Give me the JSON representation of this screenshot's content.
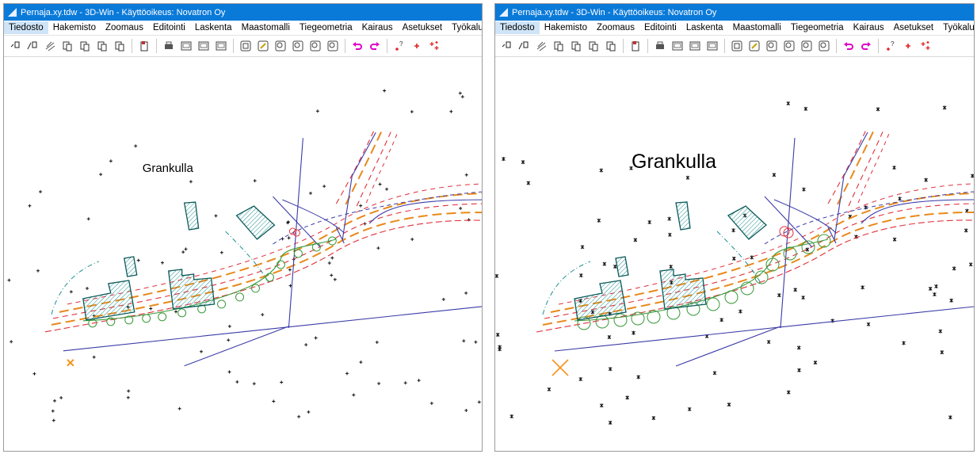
{
  "windows": [
    {
      "title": "Pernaja.xy.tdw - 3D-Win - Käyttöoikeus: Novatron Oy",
      "menu": [
        "Tiedosto",
        "Hakemisto",
        "Zoomaus",
        "Editointi",
        "Laskenta",
        "Maastomalli",
        "Tiegeometria",
        "Kairaus",
        "Asetukset",
        "Työkalut"
      ],
      "active_menu": "Tiedosto",
      "place_label": "Grankulla"
    },
    {
      "title": "Pernaja.xy.tdw - 3D-Win - Käyttöoikeus: Novatron Oy",
      "menu": [
        "Tiedosto",
        "Hakemisto",
        "Zoomaus",
        "Editointi",
        "Laskenta",
        "Maastomalli",
        "Tiegeometria",
        "Kairaus",
        "Asetukset",
        "Työkalut"
      ],
      "active_menu": "Tiedosto",
      "place_label": "Grankulla"
    }
  ],
  "toolbar_icons": [
    "new-point-icon",
    "new-line-icon",
    "layers-icon",
    "copy-file-icon",
    "paste-file-icon",
    "query-file-icon",
    "export-file-icon",
    "|",
    "clipboard-icon",
    "|",
    "print-icon",
    "scale-print-icon",
    "save-view-icon",
    "view-props-icon",
    "|",
    "zoom-extents-icon",
    "zoom-window-icon",
    "zoom-prev-icon",
    "zoom-next-icon",
    "zoom-in-icon",
    "zoom-out-icon",
    "|",
    "undo-icon",
    "redo-icon",
    "|",
    "point-query-icon",
    "add-point-icon",
    "multi-point-icon"
  ],
  "colors": {
    "titlebar": "#0a7ad9",
    "building": "#1f8f8f",
    "road_orange": "#e8891a",
    "road_red": "#e0303a",
    "road_blue": "#3a3aa8",
    "vegetation": "#3a9a3a",
    "highlight": "#f7941d"
  }
}
